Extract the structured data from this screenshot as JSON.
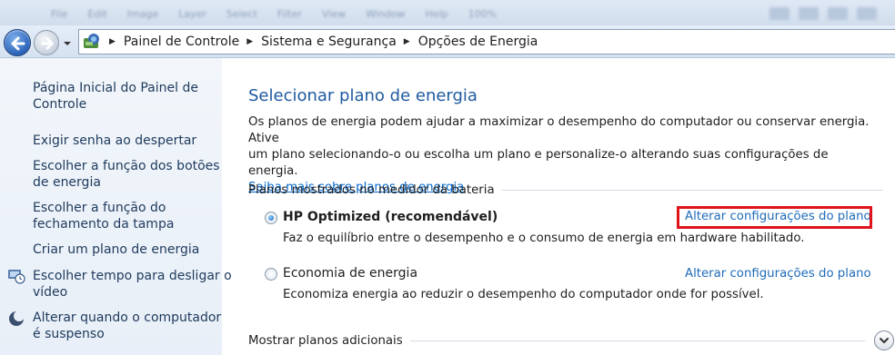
{
  "menu": {
    "items": [
      "File",
      "Edit",
      "Image",
      "Layer",
      "Select",
      "Filter",
      "View",
      "Window",
      "Help"
    ],
    "zoom": "100%"
  },
  "breadcrumb": [
    "Painel de Controle",
    "Sistema e Segurança",
    "Opções de Energia"
  ],
  "sidebar": {
    "items": [
      {
        "lines": [
          "Página Inicial do Painel de",
          "Controle"
        ],
        "icon": null
      },
      {
        "lines": [
          "Exigir senha ao despertar"
        ],
        "icon": null
      },
      {
        "lines": [
          "Escolher a função dos botões",
          "de energia"
        ],
        "icon": null
      },
      {
        "lines": [
          "Escolher a função do",
          "fechamento da tampa"
        ],
        "icon": null
      },
      {
        "lines": [
          "Criar um plano de energia"
        ],
        "icon": null
      },
      {
        "lines": [
          "Escolher tempo para desligar o",
          "vídeo"
        ],
        "icon": "display-clock-icon"
      },
      {
        "lines": [
          "Alterar quando o computador",
          "é suspenso"
        ],
        "icon": "moon-icon"
      }
    ]
  },
  "main": {
    "title": "Selecionar plano de energia",
    "desc_line1": "Os planos de energia podem ajudar a maximizar o desempenho do computador ou conservar energia. Ative",
    "desc_line2": "um plano selecionando-o ou escolha um plano e personalize-o alterando suas configurações de energia.",
    "learn_more": "Saiba mais sobre planos de energia",
    "group_label": "Planos mostrados no medidor da bateria",
    "plans": [
      {
        "name": "HP Optimized (recomendável)",
        "selected": true,
        "description": "Faz o equilíbrio entre o desempenho e o consumo de energia em hardware habilitado.",
        "link": "Alterar configurações do plano"
      },
      {
        "name": "Economia de energia",
        "selected": false,
        "description": "Economiza energia ao reduzir o desempenho do computador onde for possível.",
        "link": "Alterar configurações do plano"
      }
    ],
    "more_plans": "Mostrar planos adicionais"
  },
  "colors": {
    "highlight": "#e0121a",
    "link": "#1e6bb8",
    "title": "#1e5aa0"
  }
}
